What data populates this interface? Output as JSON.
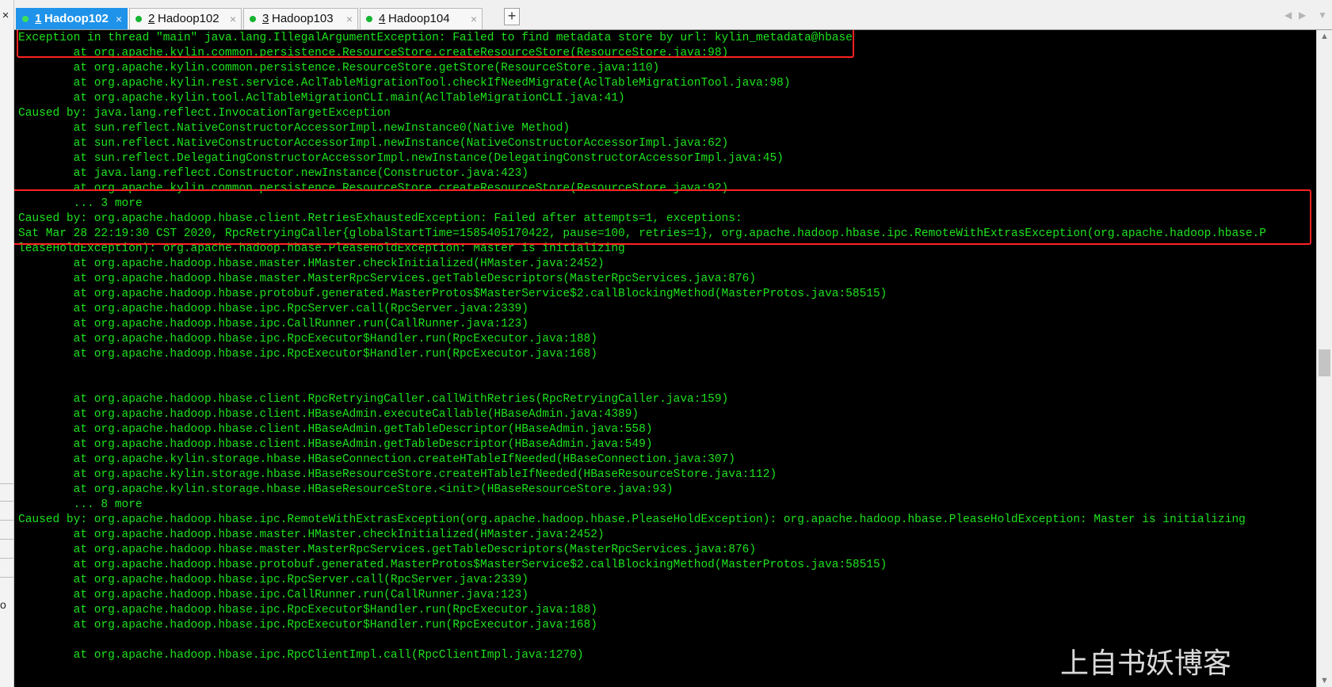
{
  "tabs": [
    {
      "number": "1",
      "label": "Hadoop102",
      "active": true
    },
    {
      "number": "2",
      "label": "Hadoop102",
      "active": false
    },
    {
      "number": "3",
      "label": "Hadoop103",
      "active": false
    },
    {
      "number": "4",
      "label": "Hadoop104",
      "active": false
    }
  ],
  "tab_close_glyph": "×",
  "new_tab_glyph": "+",
  "left_strip": {
    "close_glyph": "×",
    "letter": "o"
  },
  "terminal_lines": [
    "Exception in thread \"main\" java.lang.IllegalArgumentException: Failed to find metadata store by url: kylin_metadata@hbase",
    "        at org.apache.kylin.common.persistence.ResourceStore.createResourceStore(ResourceStore.java:98)",
    "        at org.apache.kylin.common.persistence.ResourceStore.getStore(ResourceStore.java:110)",
    "        at org.apache.kylin.rest.service.AclTableMigrationTool.checkIfNeedMigrate(AclTableMigrationTool.java:98)",
    "        at org.apache.kylin.tool.AclTableMigrationCLI.main(AclTableMigrationCLI.java:41)",
    "Caused by: java.lang.reflect.InvocationTargetException",
    "        at sun.reflect.NativeConstructorAccessorImpl.newInstance0(Native Method)",
    "        at sun.reflect.NativeConstructorAccessorImpl.newInstance(NativeConstructorAccessorImpl.java:62)",
    "        at sun.reflect.DelegatingConstructorAccessorImpl.newInstance(DelegatingConstructorAccessorImpl.java:45)",
    "        at java.lang.reflect.Constructor.newInstance(Constructor.java:423)",
    "        at org.apache.kylin.common.persistence.ResourceStore.createResourceStore(ResourceStore.java:92)",
    "        ... 3 more",
    "Caused by: org.apache.hadoop.hbase.client.RetriesExhaustedException: Failed after attempts=1, exceptions:",
    "Sat Mar 28 22:19:30 CST 2020, RpcRetryingCaller{globalStartTime=1585405170422, pause=100, retries=1}, org.apache.hadoop.hbase.ipc.RemoteWithExtrasException(org.apache.hadoop.hbase.P",
    "leaseHoldException): org.apache.hadoop.hbase.PleaseHoldException: Master is initializing",
    "        at org.apache.hadoop.hbase.master.HMaster.checkInitialized(HMaster.java:2452)",
    "        at org.apache.hadoop.hbase.master.MasterRpcServices.getTableDescriptors(MasterRpcServices.java:876)",
    "        at org.apache.hadoop.hbase.protobuf.generated.MasterProtos$MasterService$2.callBlockingMethod(MasterProtos.java:58515)",
    "        at org.apache.hadoop.hbase.ipc.RpcServer.call(RpcServer.java:2339)",
    "        at org.apache.hadoop.hbase.ipc.CallRunner.run(CallRunner.java:123)",
    "        at org.apache.hadoop.hbase.ipc.RpcExecutor$Handler.run(RpcExecutor.java:188)",
    "        at org.apache.hadoop.hbase.ipc.RpcExecutor$Handler.run(RpcExecutor.java:168)",
    "",
    "",
    "        at org.apache.hadoop.hbase.client.RpcRetryingCaller.callWithRetries(RpcRetryingCaller.java:159)",
    "        at org.apache.hadoop.hbase.client.HBaseAdmin.executeCallable(HBaseAdmin.java:4389)",
    "        at org.apache.hadoop.hbase.client.HBaseAdmin.getTableDescriptor(HBaseAdmin.java:558)",
    "        at org.apache.hadoop.hbase.client.HBaseAdmin.getTableDescriptor(HBaseAdmin.java:549)",
    "        at org.apache.kylin.storage.hbase.HBaseConnection.createHTableIfNeeded(HBaseConnection.java:307)",
    "        at org.apache.kylin.storage.hbase.HBaseResourceStore.createHTableIfNeeded(HBaseResourceStore.java:112)",
    "        at org.apache.kylin.storage.hbase.HBaseResourceStore.<init>(HBaseResourceStore.java:93)",
    "        ... 8 more",
    "Caused by: org.apache.hadoop.hbase.ipc.RemoteWithExtrasException(org.apache.hadoop.hbase.PleaseHoldException): org.apache.hadoop.hbase.PleaseHoldException: Master is initializing",
    "        at org.apache.hadoop.hbase.master.HMaster.checkInitialized(HMaster.java:2452)",
    "        at org.apache.hadoop.hbase.master.MasterRpcServices.getTableDescriptors(MasterRpcServices.java:876)",
    "        at org.apache.hadoop.hbase.protobuf.generated.MasterProtos$MasterService$2.callBlockingMethod(MasterProtos.java:58515)",
    "        at org.apache.hadoop.hbase.ipc.RpcServer.call(RpcServer.java:2339)",
    "        at org.apache.hadoop.hbase.ipc.CallRunner.run(CallRunner.java:123)",
    "        at org.apache.hadoop.hbase.ipc.RpcExecutor$Handler.run(RpcExecutor.java:188)",
    "        at org.apache.hadoop.hbase.ipc.RpcExecutor$Handler.run(RpcExecutor.java:168)",
    "",
    "        at org.apache.hadoop.hbase.ipc.RpcClientImpl.call(RpcClientImpl.java:1270)"
  ],
  "highlight_boxes": [
    {
      "covers_lines": [
        0,
        1
      ],
      "color": "#ff2222"
    },
    {
      "covers_lines": [
        12,
        14
      ],
      "color": "#ff2222"
    }
  ],
  "colors": {
    "terminal_bg": "#000000",
    "terminal_text": "#1ee31e",
    "active_tab": "#1f93ea",
    "status_dot": "#16b432",
    "highlight": "#ff2222"
  },
  "watermark": "上自书妖博客"
}
